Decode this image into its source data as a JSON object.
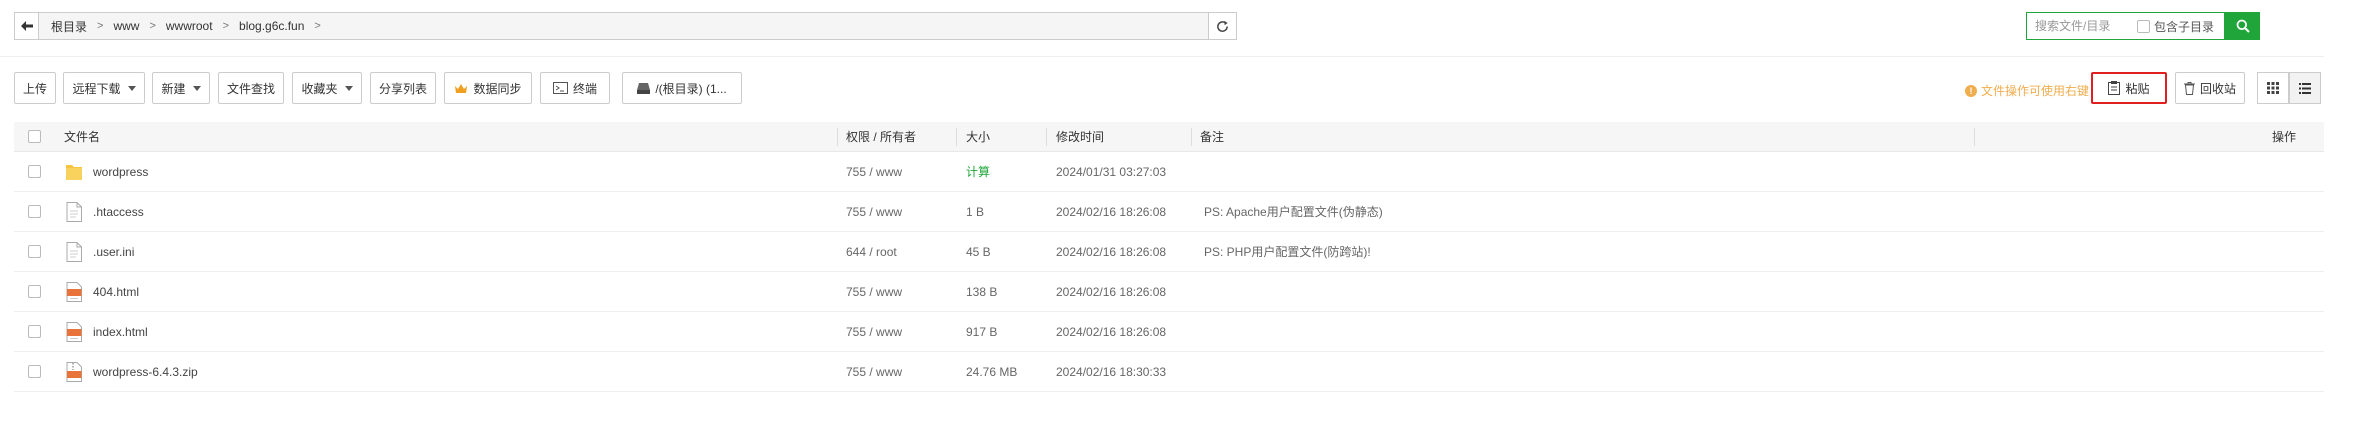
{
  "address_bar": {
    "breadcrumbs": [
      "根目录",
      "www",
      "wwwroot",
      "blog.g6c.fun"
    ]
  },
  "search": {
    "placeholder": "搜索文件/目录",
    "include_sub_label": "包含子目录"
  },
  "toolbar": {
    "upload": "上传",
    "remote_download": "远程下载",
    "new": "新建",
    "file_search": "文件查找",
    "favorites": "收藏夹",
    "share_list": "分享列表",
    "data_sync": "数据同步",
    "terminal": "终端",
    "disk": "/(根目录) (1..."
  },
  "right_toolbar": {
    "hint": "文件操作可使用右键",
    "paste": "粘贴",
    "recycle_bin": "回收站"
  },
  "table": {
    "headers": {
      "name": "文件名",
      "permission": "权限 / 所有者",
      "size": "大小",
      "mtime": "修改时间",
      "remark": "备注",
      "actions": "操作"
    },
    "rows": [
      {
        "icon": "folder-icon",
        "name": "wordpress",
        "perm": "755 / www",
        "size": "计算",
        "mtime": "2024/01/31 03:27:03",
        "remark": ""
      },
      {
        "icon": "file-icon",
        "name": ".htaccess",
        "perm": "755 / www",
        "size": "1 B",
        "mtime": "2024/02/16 18:26:08",
        "remark": "PS: Apache用户配置文件(伪静态)"
      },
      {
        "icon": "file-icon",
        "name": ".user.ini",
        "perm": "644 / root",
        "size": "45 B",
        "mtime": "2024/02/16 18:26:08",
        "remark": "PS: PHP用户配置文件(防跨站)!"
      },
      {
        "icon": "html-file-icon",
        "name": "404.html",
        "perm": "755 / www",
        "size": "138 B",
        "mtime": "2024/02/16 18:26:08",
        "remark": ""
      },
      {
        "icon": "html-file-icon",
        "name": "index.html",
        "perm": "755 / www",
        "size": "917 B",
        "mtime": "2024/02/16 18:26:08",
        "remark": ""
      },
      {
        "icon": "zip-file-icon",
        "name": "wordpress-6.4.3.zip",
        "perm": "755 / www",
        "size": "24.76 MB",
        "mtime": "2024/02/16 18:30:33",
        "remark": ""
      }
    ]
  },
  "colors": {
    "accent_green": "#20a53a",
    "hint_orange": "#f0ad4e",
    "highlight_red": "#e02020"
  }
}
